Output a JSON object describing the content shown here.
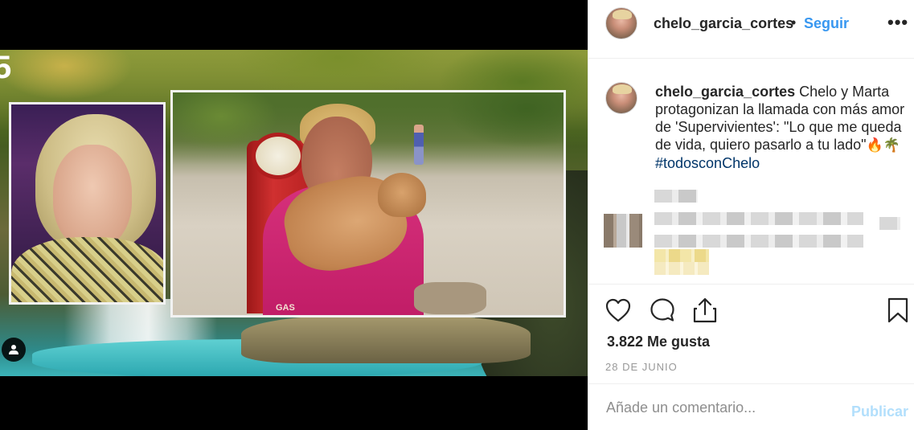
{
  "post": {
    "username": "chelo_garcia_cortes",
    "separator": "•",
    "follow_label": "Seguir",
    "more_label": "•••"
  },
  "media": {
    "channel_number": "5",
    "pump_label": "GAS"
  },
  "caption": {
    "username": "chelo_garcia_cortes",
    "text": "Chelo y Marta protagonizan la llamada con más amor de 'Supervivientes': \"Lo que me queda de vida, quiero pasarlo a tu lado\"",
    "emoji": "🔥🌴",
    "hashtag": "#todosconChelo"
  },
  "actions": {
    "like_icon": "heart-icon",
    "comment_icon": "comment-icon",
    "share_icon": "share-icon",
    "save_icon": "bookmark-icon"
  },
  "stats": {
    "likes": "3.822 Me gusta",
    "date": "28 DE JUNIO"
  },
  "comment_form": {
    "placeholder": "Añade un comentario...",
    "publish_label": "Publicar"
  },
  "colors": {
    "link": "#3897f0",
    "hashtag": "#003569",
    "publish_disabled": "#b2dffc"
  }
}
